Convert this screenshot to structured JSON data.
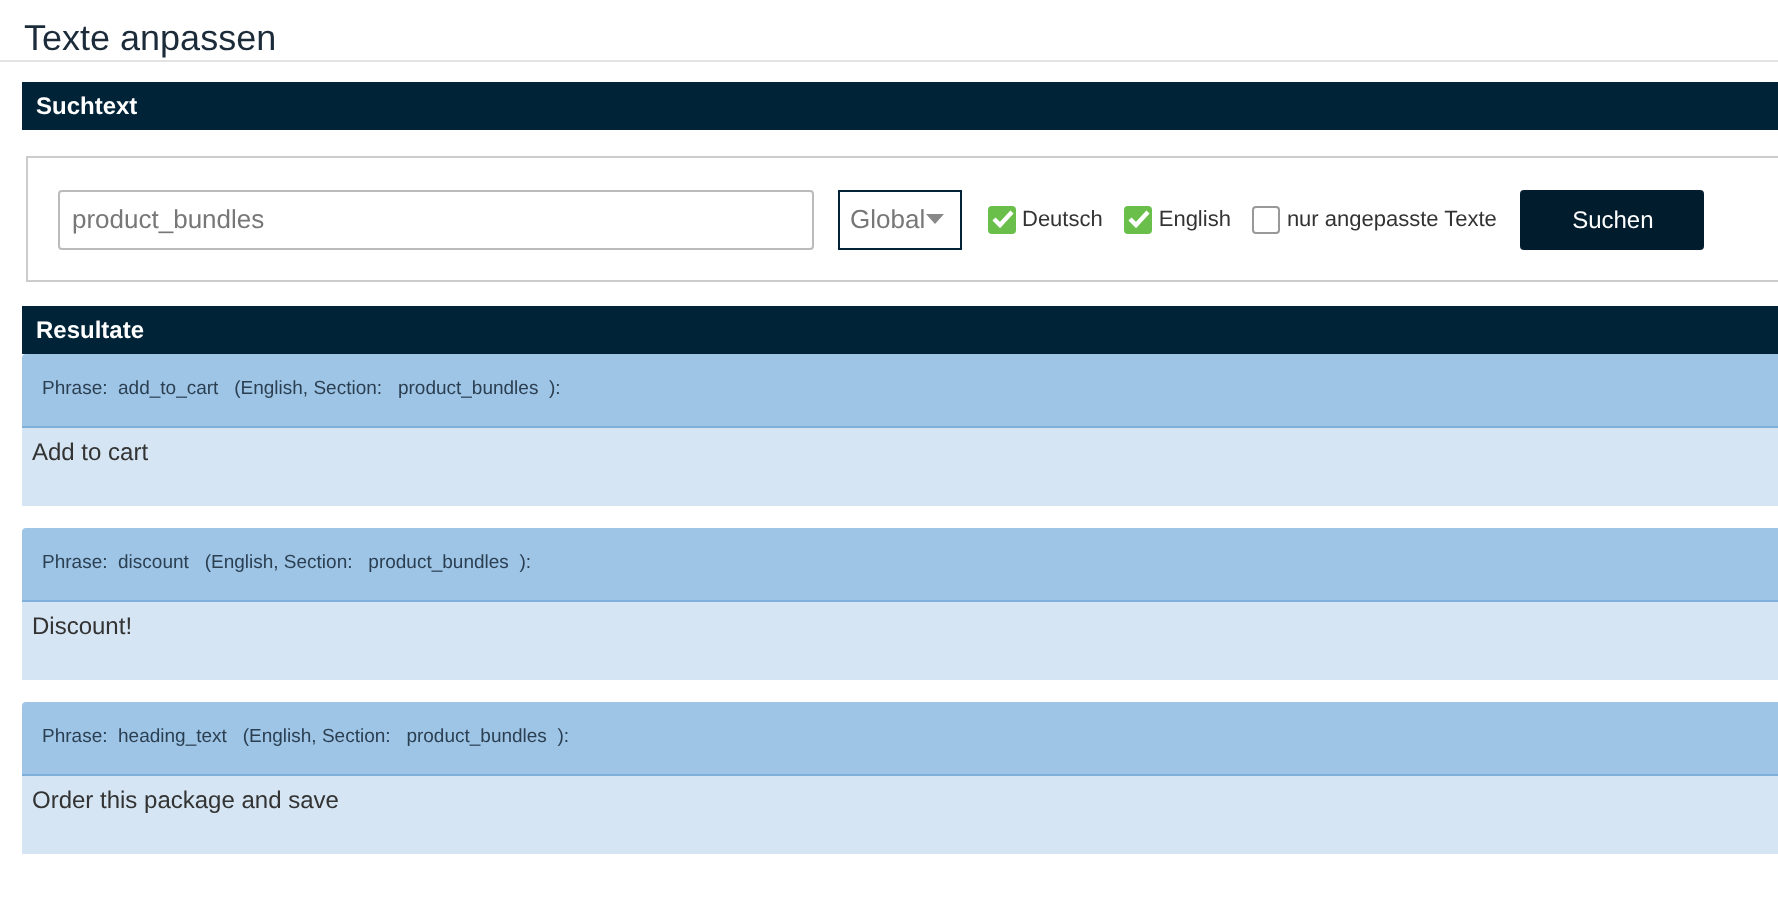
{
  "page_title": "Texte anpassen",
  "search_section": {
    "title": "Suchtext",
    "query": "product_bundles",
    "scope": "Global",
    "options": [
      {
        "label": "Deutsch",
        "checked": true
      },
      {
        "label": "English",
        "checked": true
      },
      {
        "label": "nur angepasste Texte",
        "checked": false
      }
    ],
    "button": "Suchen"
  },
  "results_section": {
    "title": "Resultate",
    "results": [
      {
        "header": "Phrase:  add_to_cart   (English, Section:   product_bundles  ):",
        "text": "Add to cart"
      },
      {
        "header": "Phrase:  discount   (English, Section:   product_bundles  ):",
        "text": "Discount!"
      },
      {
        "header": "Phrase:  heading_text   (English, Section:   product_bundles  ):",
        "text": "Order this package and save"
      }
    ]
  }
}
